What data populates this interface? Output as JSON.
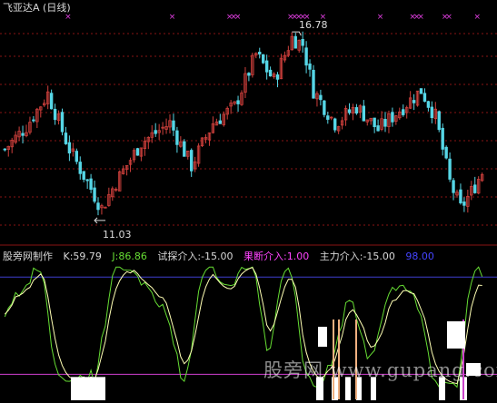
{
  "window": {
    "title": "飞亚达A (日线)"
  },
  "price_pane": {
    "high_label": "16.78",
    "low_label": "11.03"
  },
  "indicator_bar": {
    "name": "股旁网制作",
    "k": "K:59.79",
    "j": "J:86.86",
    "trial": "试探介入:-15.00",
    "decisive": "果断介入:1.00",
    "main": "主力介入:-15.00",
    "level": "98.00"
  },
  "watermark": "股旁网 www.gupang.com",
  "colors": {
    "background": "#000000",
    "up_candle": "#d0403c",
    "down_candle": "#56d6e6",
    "grid": "#8a1414",
    "marker": "#e23ee2",
    "k_line": "#ffffb4",
    "j_line": "#66dd33",
    "trial_color": "#d8d8d8",
    "decisive_color": "#ff44ff",
    "main_color": "#d8d8d8",
    "level_line": "#3f3fd0",
    "bottom_line": "#d040d0"
  },
  "chart_data": {
    "type": "candlestick",
    "price_range": [
      10.5,
      17.2
    ],
    "high": 16.78,
    "low": 11.03,
    "marker_clusters": [
      {
        "index": 17,
        "count": 1
      },
      {
        "index": 46,
        "count": 1
      },
      {
        "index": 62,
        "count": 3
      },
      {
        "index": 79,
        "count": 5
      },
      {
        "index": 88,
        "count": 1
      },
      {
        "index": 104,
        "count": 1
      },
      {
        "index": 113,
        "count": 3
      },
      {
        "index": 122,
        "count": 2
      },
      {
        "index": 131,
        "count": 1
      }
    ],
    "indicator": {
      "range": [
        -15,
        110
      ],
      "upper_level": 98,
      "lower_level": 1
    }
  }
}
